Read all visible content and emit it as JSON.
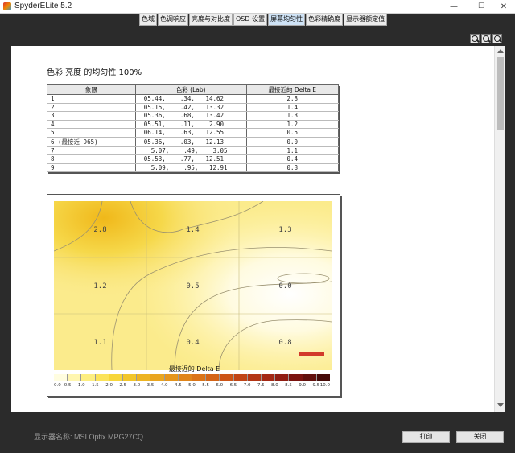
{
  "window": {
    "title": "SpyderELite 5.2",
    "min": "—",
    "max": "☐",
    "close": "✕"
  },
  "tabs": [
    {
      "label": "色域",
      "active": false
    },
    {
      "label": "色调响应",
      "active": false
    },
    {
      "label": "亮度与对比度",
      "active": false
    },
    {
      "label": "OSD 设置",
      "active": false
    },
    {
      "label": "屏幕均匀性",
      "active": true
    },
    {
      "label": "色彩精确度",
      "active": false
    },
    {
      "label": "显示器额定值",
      "active": false
    }
  ],
  "zoom_icons": [
    "zoom-in-icon",
    "zoom-out-icon",
    "zoom-fit-icon"
  ],
  "report": {
    "title": "色彩 亮度 的均匀性 100%",
    "table": {
      "headers": [
        "象限",
        "色彩 (Lab)",
        "最接近的 Delta E"
      ],
      "rows": [
        [
          "1",
          "05.44,    .34,   14.62",
          "2.8"
        ],
        [
          "2",
          "05.15,    .42,   13.32",
          "1.4"
        ],
        [
          "3",
          "05.36,    .68,   13.42",
          "1.3"
        ],
        [
          "4",
          "05.51,    .11,    2.90",
          "1.2"
        ],
        [
          "5",
          "06.14,    .63,   12.55",
          "0.5"
        ],
        [
          "6 (最接近 D65)",
          "05.36,    .03,   12.13",
          "0.0"
        ],
        [
          "7",
          "  5.07,    .49,    3.05",
          "1.1"
        ],
        [
          "8",
          "05.53,    .77,   12.51",
          "0.4"
        ],
        [
          "9",
          "  5.09,    .95,   12.91",
          "0.8"
        ]
      ]
    }
  },
  "chart_data": {
    "type": "heatmap",
    "title": "最接近的 Delta E",
    "grid": true,
    "rows": 3,
    "cols": 3,
    "values": [
      [
        2.8,
        1.4,
        1.3
      ],
      [
        1.2,
        0.5,
        0.0
      ],
      [
        1.1,
        0.4,
        0.8
      ]
    ],
    "value_labels": [
      "2.8",
      "1.4",
      "1.3",
      "1.2",
      "0.5",
      "0.0",
      "1.1",
      "0.4",
      "0.8"
    ],
    "colorbar": {
      "ticks": [
        "0.0",
        "0.5",
        "1.0",
        "1.5",
        "2.0",
        "2.5",
        "3.0",
        "3.5",
        "4.0",
        "4.5",
        "5.0",
        "5.5",
        "6.0",
        "6.5",
        "7.0",
        "7.5",
        "8.0",
        "8.5",
        "9.0",
        "9.5",
        "10.0"
      ],
      "range": [
        0,
        10
      ],
      "colors": [
        "#fffde0",
        "#fff6b0",
        "#fdee80",
        "#fbe35a",
        "#f7d63a",
        "#f2c62a",
        "#edb422",
        "#e9a51f",
        "#e5951c",
        "#e0851a",
        "#db7418",
        "#d46417",
        "#cc5416",
        "#c14516",
        "#b43615",
        "#a42814",
        "#911d12",
        "#7b140f",
        "#62100c",
        "#460b08"
      ]
    }
  },
  "footer": {
    "display_name": "显示器名称: MSI Optix MPG27CQ",
    "print_button": "打印",
    "close_button": "关闭"
  }
}
